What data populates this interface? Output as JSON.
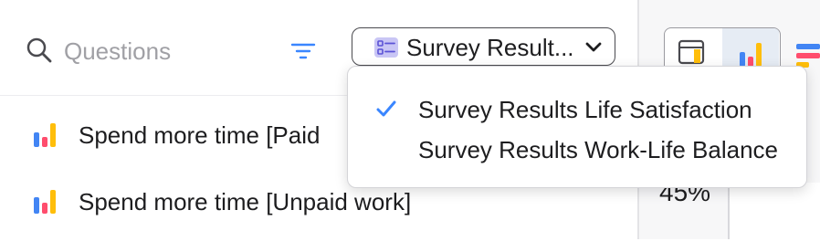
{
  "search": {
    "placeholder": "Questions"
  },
  "dataset_select": {
    "selected_label": "Survey Result..."
  },
  "questions": [
    {
      "label": "Spend more time [Paid"
    },
    {
      "label": "Spend more time [Unpaid work]"
    }
  ],
  "dropdown": {
    "options": [
      {
        "label": "Survey Results Life Satisfaction",
        "selected": true
      },
      {
        "label": "Survey Results Work-Life Balance",
        "selected": false
      }
    ]
  },
  "chart_preview": {
    "value_text": "45%"
  },
  "colors": {
    "accent": "#3a86ff",
    "bar_blue": "#4285f4",
    "bar_pink": "#ff4d6d",
    "bar_yellow": "#ffbe0b"
  }
}
